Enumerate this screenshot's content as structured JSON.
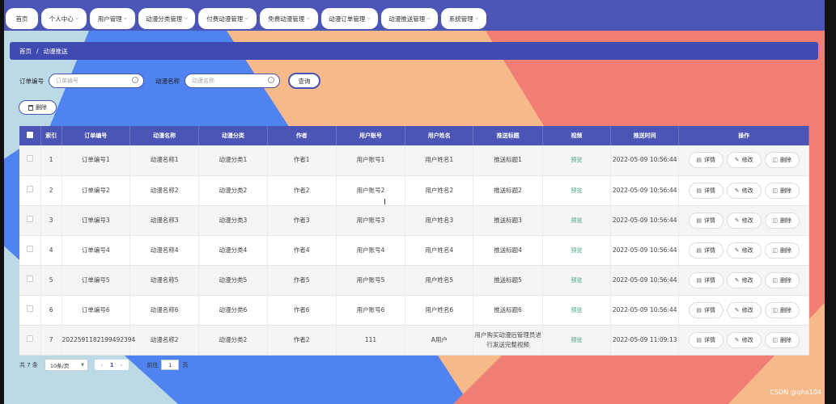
{
  "nav": {
    "tabs": [
      {
        "label": "首页",
        "has_dropdown": false
      },
      {
        "label": "个人中心",
        "has_dropdown": true
      },
      {
        "label": "用户管理",
        "has_dropdown": true
      },
      {
        "label": "动漫分类管理",
        "has_dropdown": true
      },
      {
        "label": "付费动漫管理",
        "has_dropdown": true
      },
      {
        "label": "免费动漫管理",
        "has_dropdown": true
      },
      {
        "label": "动漫订单管理",
        "has_dropdown": true
      },
      {
        "label": "动漫推送管理",
        "has_dropdown": true
      },
      {
        "label": "系统管理",
        "has_dropdown": true
      }
    ]
  },
  "breadcrumb": {
    "home": "首页",
    "separator": "/",
    "current": "动漫推送"
  },
  "search": {
    "order_label": "订单编号",
    "order_placeholder": "订单编号",
    "name_label": "动漫名称",
    "name_placeholder": "动漫名称",
    "query_button": "查询"
  },
  "toolbar": {
    "delete_button": "删除"
  },
  "table": {
    "headers": [
      "",
      "索引",
      "订单编号",
      "动漫名称",
      "动漫分类",
      "作者",
      "用户账号",
      "用户姓名",
      "推送标题",
      "视频",
      "推送时间",
      "操作"
    ],
    "video_label": "预览",
    "actions": {
      "detail": "详情",
      "edit": "修改",
      "delete": "删除"
    },
    "rows": [
      {
        "index": "1",
        "order": "订单编号1",
        "name": "动漫名称1",
        "category": "动漫分类1",
        "author": "作者1",
        "account": "用户账号1",
        "username": "用户姓名1",
        "title": "推送标题1",
        "time": "2022-05-09 10:56:44"
      },
      {
        "index": "2",
        "order": "订单编号2",
        "name": "动漫名称2",
        "category": "动漫分类2",
        "author": "作者2",
        "account": "用户账号2",
        "username": "用户姓名2",
        "title": "推送标题2",
        "time": "2022-05-09 10:56:44"
      },
      {
        "index": "3",
        "order": "订单编号3",
        "name": "动漫名称3",
        "category": "动漫分类3",
        "author": "作者3",
        "account": "用户账号3",
        "username": "用户姓名3",
        "title": "推送标题3",
        "time": "2022-05-09 10:56:44"
      },
      {
        "index": "4",
        "order": "订单编号4",
        "name": "动漫名称4",
        "category": "动漫分类4",
        "author": "作者4",
        "account": "用户账号4",
        "username": "用户姓名4",
        "title": "推送标题4",
        "time": "2022-05-09 10:56:44"
      },
      {
        "index": "5",
        "order": "订单编号5",
        "name": "动漫名称5",
        "category": "动漫分类5",
        "author": "作者5",
        "account": "用户账号5",
        "username": "用户姓名5",
        "title": "推送标题5",
        "time": "2022-05-09 10:56:44"
      },
      {
        "index": "6",
        "order": "订单编号6",
        "name": "动漫名称6",
        "category": "动漫分类6",
        "author": "作者6",
        "account": "用户账号6",
        "username": "用户姓名6",
        "title": "推送标题6",
        "time": "2022-05-09 10:56:44"
      },
      {
        "index": "7",
        "order": "2022591182199492394",
        "name": "动漫名称2",
        "category": "动漫分类2",
        "author": "作者2",
        "account": "111",
        "username": "A用户",
        "title": "用户购买动漫后管理员进行发送完整视频",
        "time": "2022-05-09 11:09:13"
      }
    ]
  },
  "pager": {
    "total": "共 7 条",
    "page_size": "10条/页",
    "prev": "‹",
    "current_page": "1",
    "next": "›",
    "goto_label": "前往",
    "goto_value": "1",
    "page_unit": "页"
  },
  "watermark": "CSDN @qha104",
  "colors": {
    "primary": "#4a55b5",
    "link_green": "#3aa77a"
  }
}
